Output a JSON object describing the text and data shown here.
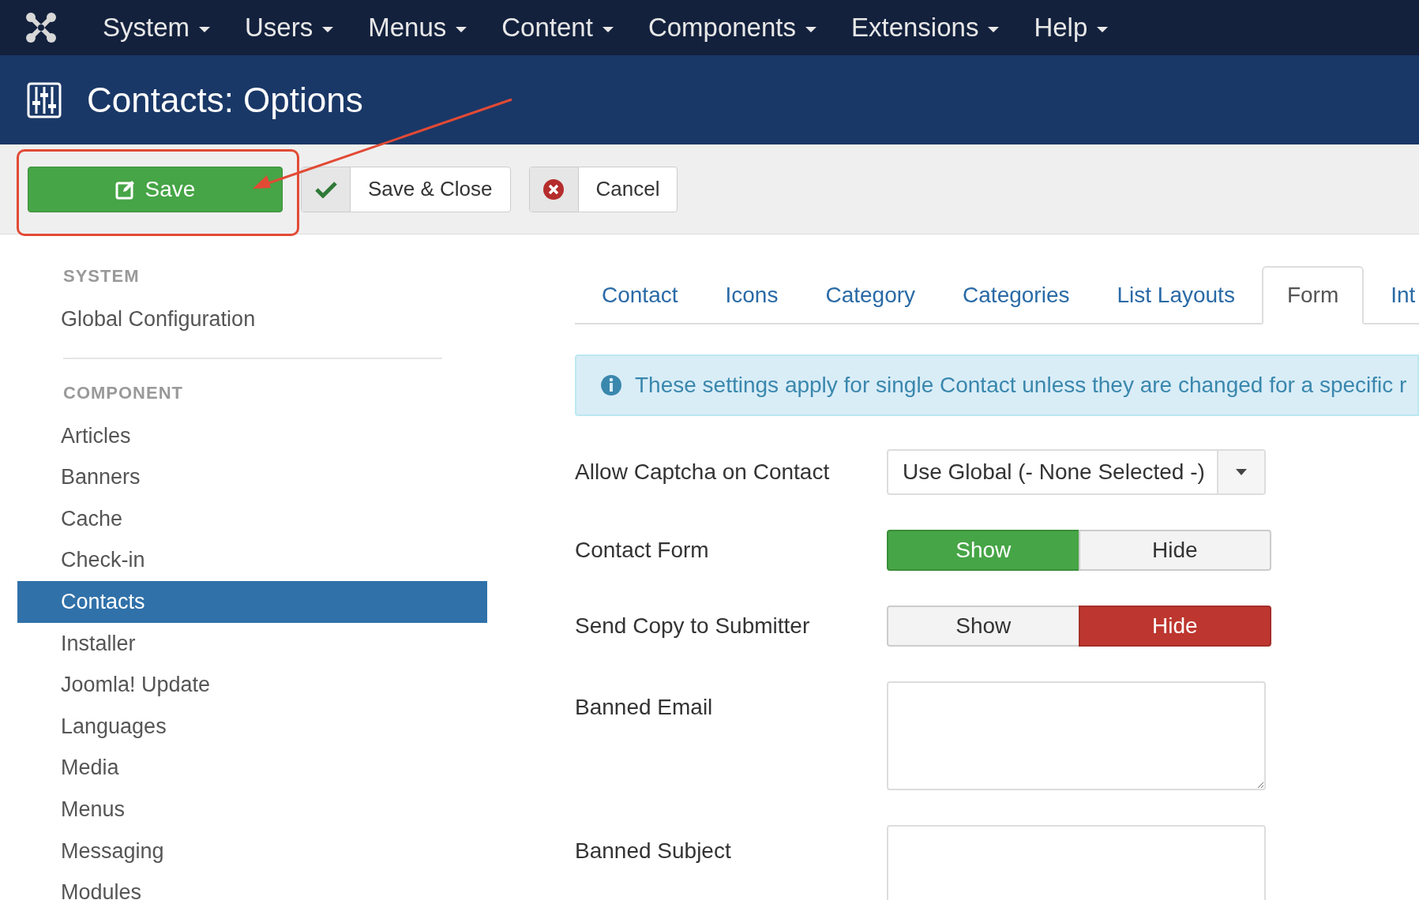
{
  "menu_bar": {
    "items": [
      {
        "label": "System"
      },
      {
        "label": "Users"
      },
      {
        "label": "Menus"
      },
      {
        "label": "Content"
      },
      {
        "label": "Components"
      },
      {
        "label": "Extensions"
      },
      {
        "label": "Help"
      }
    ]
  },
  "header": {
    "title": "Contacts: Options"
  },
  "toolbar": {
    "buttons": [
      {
        "label": "Save",
        "kind": "primary",
        "highlighted": true
      },
      {
        "label": "Save & Close",
        "kind": "split",
        "highlighted": false
      },
      {
        "label": "Cancel",
        "kind": "split",
        "highlighted": false
      }
    ]
  },
  "sidebar": {
    "sections": [
      {
        "heading": "SYSTEM",
        "items": [
          {
            "label": "Global Configuration",
            "selected": false
          }
        ]
      },
      {
        "heading": "COMPONENT",
        "items": [
          {
            "label": "Articles",
            "selected": false
          },
          {
            "label": "Banners",
            "selected": false
          },
          {
            "label": "Cache",
            "selected": false
          },
          {
            "label": "Check-in",
            "selected": false
          },
          {
            "label": "Contacts",
            "selected": true
          },
          {
            "label": "Installer",
            "selected": false
          },
          {
            "label": "Joomla! Update",
            "selected": false
          },
          {
            "label": "Languages",
            "selected": false
          },
          {
            "label": "Media",
            "selected": false
          },
          {
            "label": "Menus",
            "selected": false
          },
          {
            "label": "Messaging",
            "selected": false
          },
          {
            "label": "Modules",
            "selected": false
          }
        ]
      }
    ]
  },
  "tabs": [
    {
      "label": "Contact",
      "selected": false
    },
    {
      "label": "Icons",
      "selected": false
    },
    {
      "label": "Category",
      "selected": false
    },
    {
      "label": "Categories",
      "selected": false
    },
    {
      "label": "List Layouts",
      "selected": false
    },
    {
      "label": "Form",
      "selected": true
    },
    {
      "label": "Int",
      "selected": false
    }
  ],
  "info": "These settings apply for single Contact unless they are changed for a specific r",
  "fields": [
    {
      "label": "Allow Captcha on Contact",
      "kind": "select",
      "value": "Use Global (- None Selected -)"
    },
    {
      "label": "Contact Form",
      "kind": "toggle",
      "options": [
        {
          "label": "Show",
          "kind": "yes",
          "selected": true
        },
        {
          "label": "Hide",
          "kind": "no",
          "selected": false
        }
      ]
    },
    {
      "label": "Send Copy to Submitter",
      "kind": "toggle",
      "options": [
        {
          "label": "Show",
          "kind": "yes",
          "selected": false
        },
        {
          "label": "Hide",
          "kind": "no",
          "selected": true
        }
      ]
    },
    {
      "label": "Banned Email",
      "kind": "textarea"
    },
    {
      "label": "Banned Subject",
      "kind": "textarea"
    }
  ]
}
